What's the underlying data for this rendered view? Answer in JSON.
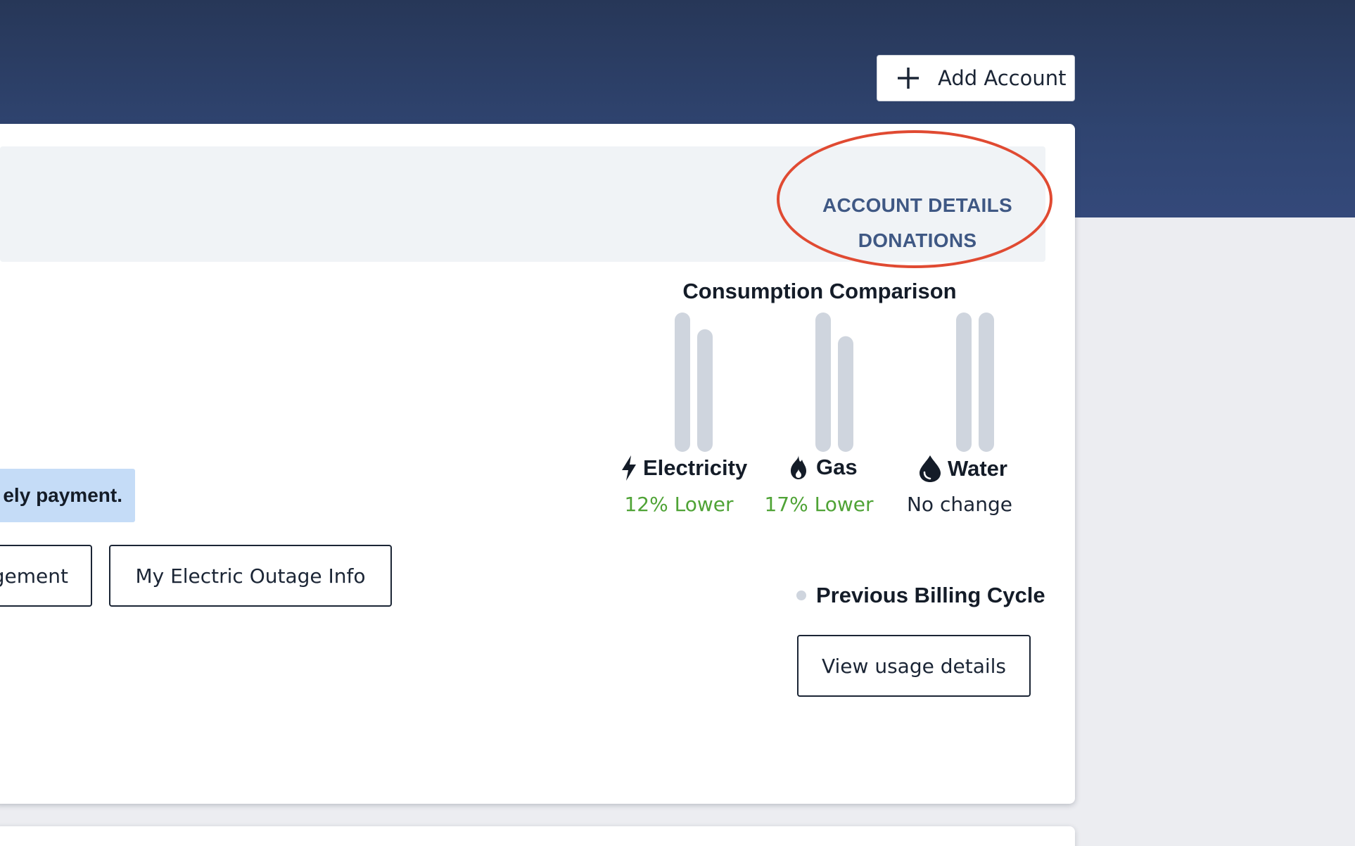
{
  "header": {
    "add_account_label": "Add Account"
  },
  "account_card": {
    "links": {
      "account_details": "ACCOUNT DETAILS",
      "donations": "DONATIONS"
    },
    "notice_text": "ely payment.",
    "buttons": {
      "management_partial": "gement",
      "outage_info": "My Electric Outage Info",
      "view_usage": "View usage details"
    }
  },
  "consumption": {
    "title": "Consumption Comparison",
    "legend_label": "Previous Billing Cycle",
    "utilities": [
      {
        "name": "Electricity",
        "icon": "bolt-icon",
        "change_text": "12% Lower"
      },
      {
        "name": "Gas",
        "icon": "flame-icon",
        "change_text": "17% Lower"
      },
      {
        "name": "Water",
        "icon": "water-drop-icon",
        "change_text": "No change"
      }
    ]
  },
  "chart_data": {
    "type": "bar",
    "categories": [
      "Electricity",
      "Gas",
      "Water"
    ],
    "series": [
      {
        "name": "Previous Billing Cycle",
        "values": [
          100,
          100,
          100
        ]
      },
      {
        "values": [
          88,
          83,
          100
        ]
      }
    ],
    "title": "Consumption Comparison",
    "ylim": [
      0,
      100
    ]
  },
  "colors": {
    "header_band": "#2f4470",
    "link": "#3f5884",
    "highlight_oval": "#e04a32",
    "notice_bg": "#c5dcf7",
    "previous_bar": "#cfd5de",
    "lower_bar": "#55aa3a",
    "lower_text": "#4fa336",
    "neutral_text": "#1b2535"
  }
}
